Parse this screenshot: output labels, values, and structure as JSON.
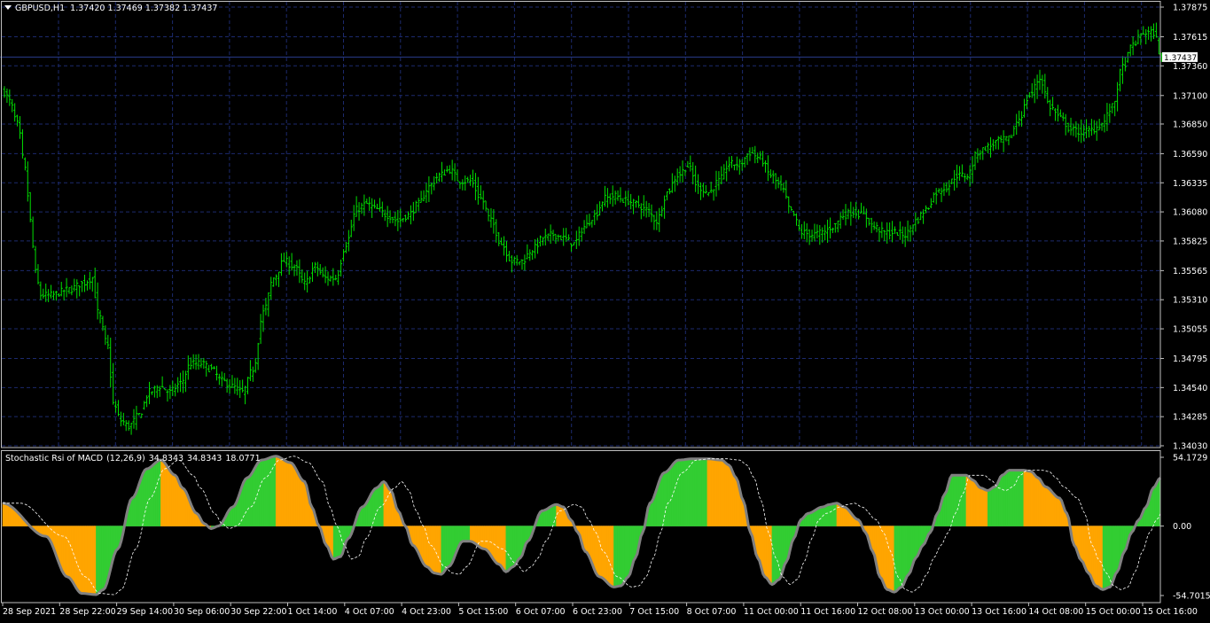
{
  "main_chart": {
    "symbol": "GBPUSD,H1",
    "ohlc": [
      "1.37420",
      "1.37469",
      "1.37382",
      "1.37437"
    ],
    "price_levels": [
      "1.37875",
      "1.37615",
      "1.37360",
      "1.37100",
      "1.36850",
      "1.36590",
      "1.36335",
      "1.36080",
      "1.35825",
      "1.35565",
      "1.35310",
      "1.35055",
      "1.34795",
      "1.34540",
      "1.34285",
      "1.34030"
    ],
    "current_price": "1.37437",
    "colors": {
      "background": "#000000",
      "grid": "#1c2a6e",
      "bars": "#00e000",
      "price_line": "#283c8c",
      "axis": "#c0c0c0"
    }
  },
  "indicator": {
    "name": "Stochastic Rsi of MACD",
    "params": "(12,26,9)",
    "values": [
      "34.8343",
      "34.8343",
      "18.0771"
    ],
    "levels": [
      "54.1729",
      "0.00",
      "-54.7015"
    ],
    "colors": {
      "up": "#32cd32",
      "down": "#ffa500",
      "line": "#808080",
      "signal": "#ffffff"
    }
  },
  "time_axis": {
    "labels": [
      "28 Sep 2021",
      "28 Sep 22:00",
      "29 Sep 14:00",
      "30 Sep 06:00",
      "30 Sep 22:00",
      "1 Oct 14:00",
      "4 Oct 07:00",
      "4 Oct 23:00",
      "5 Oct 15:00",
      "6 Oct 07:00",
      "6 Oct 23:00",
      "7 Oct 15:00",
      "8 Oct 07:00",
      "11 Oct 00:00",
      "11 Oct 16:00",
      "12 Oct 08:00",
      "13 Oct 00:00",
      "13 Oct 16:00",
      "14 Oct 08:00",
      "15 Oct 00:00",
      "15 Oct 16:00"
    ]
  },
  "chart_data": {
    "type": "ohlc",
    "title": "GBPUSD,H1",
    "ylim": [
      1.3403,
      1.37875
    ],
    "x_range": [
      "28 Sep 2021",
      "15 Oct 16:00"
    ],
    "grid": true,
    "anchors": [
      [
        0,
        1.3713
      ],
      [
        2,
        1.3705
      ],
      [
        5,
        1.3685
      ],
      [
        8,
        1.3645
      ],
      [
        10,
        1.36
      ],
      [
        12,
        1.3555
      ],
      [
        14,
        1.3535
      ],
      [
        18,
        1.3535
      ],
      [
        25,
        1.354
      ],
      [
        30,
        1.3545
      ],
      [
        34,
        1.355
      ],
      [
        36,
        1.352
      ],
      [
        40,
        1.349
      ],
      [
        42,
        1.344
      ],
      [
        45,
        1.3425
      ],
      [
        48,
        1.342
      ],
      [
        52,
        1.343
      ],
      [
        56,
        1.345
      ],
      [
        60,
        1.3455
      ],
      [
        64,
        1.345
      ],
      [
        68,
        1.3458
      ],
      [
        72,
        1.3475
      ],
      [
        76,
        1.3475
      ],
      [
        80,
        1.347
      ],
      [
        84,
        1.346
      ],
      [
        88,
        1.3455
      ],
      [
        92,
        1.345
      ],
      [
        96,
        1.347
      ],
      [
        100,
        1.352
      ],
      [
        104,
        1.355
      ],
      [
        108,
        1.3565
      ],
      [
        112,
        1.356
      ],
      [
        116,
        1.3545
      ],
      [
        120,
        1.356
      ],
      [
        124,
        1.355
      ],
      [
        128,
        1.355
      ],
      [
        132,
        1.358
      ],
      [
        136,
        1.361
      ],
      [
        140,
        1.3615
      ],
      [
        144,
        1.361
      ],
      [
        148,
        1.3605
      ],
      [
        152,
        1.36
      ],
      [
        156,
        1.3605
      ],
      [
        160,
        1.3615
      ],
      [
        164,
        1.363
      ],
      [
        168,
        1.364
      ],
      [
        172,
        1.3645
      ],
      [
        176,
        1.3635
      ],
      [
        180,
        1.3635
      ],
      [
        184,
        1.362
      ],
      [
        188,
        1.36
      ],
      [
        192,
        1.358
      ],
      [
        196,
        1.3565
      ],
      [
        200,
        1.3565
      ],
      [
        204,
        1.3575
      ],
      [
        208,
        1.3585
      ],
      [
        212,
        1.3588
      ],
      [
        216,
        1.3585
      ],
      [
        220,
        1.358
      ],
      [
        224,
        1.3595
      ],
      [
        228,
        1.3605
      ],
      [
        232,
        1.362
      ],
      [
        236,
        1.3622
      ],
      [
        240,
        1.3618
      ],
      [
        244,
        1.3615
      ],
      [
        248,
        1.361
      ],
      [
        252,
        1.36
      ],
      [
        256,
        1.3625
      ],
      [
        260,
        1.364
      ],
      [
        264,
        1.3648
      ],
      [
        268,
        1.363
      ],
      [
        272,
        1.3625
      ],
      [
        276,
        1.3635
      ],
      [
        280,
        1.365
      ],
      [
        284,
        1.365
      ],
      [
        288,
        1.366
      ],
      [
        292,
        1.3655
      ],
      [
        296,
        1.364
      ],
      [
        300,
        1.363
      ],
      [
        304,
        1.3608
      ],
      [
        308,
        1.359
      ],
      [
        312,
        1.3588
      ],
      [
        316,
        1.359
      ],
      [
        320,
        1.3595
      ],
      [
        324,
        1.3605
      ],
      [
        328,
        1.3608
      ],
      [
        332,
        1.3605
      ],
      [
        336,
        1.3595
      ],
      [
        340,
        1.359
      ],
      [
        344,
        1.359
      ],
      [
        348,
        1.3588
      ],
      [
        352,
        1.36
      ],
      [
        356,
        1.361
      ],
      [
        360,
        1.3625
      ],
      [
        364,
        1.363
      ],
      [
        368,
        1.364
      ],
      [
        372,
        1.364
      ],
      [
        376,
        1.366
      ],
      [
        380,
        1.3665
      ],
      [
        384,
        1.367
      ],
      [
        388,
        1.3672
      ],
      [
        392,
        1.369
      ],
      [
        396,
        1.371
      ],
      [
        400,
        1.3725
      ],
      [
        404,
        1.37
      ],
      [
        408,
        1.369
      ],
      [
        412,
        1.368
      ],
      [
        416,
        1.3678
      ],
      [
        420,
        1.368
      ],
      [
        424,
        1.3685
      ],
      [
        428,
        1.37
      ],
      [
        432,
        1.3735
      ],
      [
        436,
        1.3755
      ],
      [
        440,
        1.3765
      ],
      [
        444,
        1.3765
      ],
      [
        447,
        1.3743
      ]
    ]
  },
  "indicator_data": {
    "anchors": [
      [
        0,
        18
      ],
      [
        6,
        -8
      ],
      [
        9,
        -40
      ],
      [
        11,
        -53
      ],
      [
        13,
        -54
      ],
      [
        14,
        -50
      ],
      [
        16,
        -18
      ],
      [
        18,
        22
      ],
      [
        20,
        45
      ],
      [
        22,
        52
      ],
      [
        24,
        40
      ],
      [
        25,
        30
      ],
      [
        27,
        10
      ],
      [
        28,
        2
      ],
      [
        29,
        -2
      ],
      [
        30,
        0
      ],
      [
        32,
        15
      ],
      [
        34,
        38
      ],
      [
        36,
        52
      ],
      [
        38,
        55
      ],
      [
        40,
        50
      ],
      [
        42,
        35
      ],
      [
        43,
        15
      ],
      [
        44,
        0
      ],
      [
        45,
        -15
      ],
      [
        46,
        -26
      ],
      [
        47,
        -24
      ],
      [
        48,
        -10
      ],
      [
        50,
        15
      ],
      [
        52,
        30
      ],
      [
        53,
        35
      ],
      [
        54,
        28
      ],
      [
        55,
        12
      ],
      [
        56,
        0
      ],
      [
        57,
        -15
      ],
      [
        59,
        -32
      ],
      [
        60,
        -37
      ],
      [
        61,
        -38
      ],
      [
        62,
        -32
      ],
      [
        64,
        -12
      ],
      [
        65,
        -12
      ],
      [
        67,
        -18
      ],
      [
        69,
        -30
      ],
      [
        70,
        -36
      ],
      [
        71,
        -32
      ],
      [
        72,
        -25
      ],
      [
        73,
        -12
      ],
      [
        75,
        12
      ],
      [
        77,
        17
      ],
      [
        78,
        15
      ],
      [
        79,
        5
      ],
      [
        80,
        -5
      ],
      [
        81,
        -20
      ],
      [
        83,
        -40
      ],
      [
        85,
        -48
      ],
      [
        86,
        -47
      ],
      [
        87,
        -40
      ],
      [
        88,
        -25
      ],
      [
        89,
        -5
      ],
      [
        90,
        18
      ],
      [
        92,
        42
      ],
      [
        94,
        52
      ],
      [
        96,
        53
      ],
      [
        98,
        53
      ],
      [
        100,
        52
      ],
      [
        101,
        48
      ],
      [
        102,
        38
      ],
      [
        103,
        20
      ],
      [
        104,
        -5
      ],
      [
        105,
        -25
      ],
      [
        106,
        -40
      ],
      [
        107,
        -46
      ],
      [
        108,
        -42
      ],
      [
        109,
        -28
      ],
      [
        110,
        -10
      ],
      [
        111,
        5
      ],
      [
        112,
        10
      ],
      [
        114,
        15
      ],
      [
        115,
        17
      ],
      [
        116,
        18
      ],
      [
        117,
        15
      ],
      [
        119,
        5
      ],
      [
        120,
        -5
      ],
      [
        121,
        -20
      ],
      [
        122,
        -40
      ],
      [
        123,
        -50
      ],
      [
        124,
        -52
      ],
      [
        125,
        -48
      ],
      [
        126,
        -38
      ],
      [
        127,
        -25
      ],
      [
        128,
        -15
      ],
      [
        129,
        -5
      ],
      [
        130,
        10
      ],
      [
        131,
        25
      ],
      [
        132,
        40
      ],
      [
        134,
        40
      ],
      [
        135,
        36
      ],
      [
        136,
        30
      ],
      [
        137,
        28
      ],
      [
        138,
        31
      ],
      [
        139,
        40
      ],
      [
        140,
        44
      ],
      [
        142,
        44
      ],
      [
        143,
        43
      ],
      [
        144,
        38
      ],
      [
        145,
        31
      ],
      [
        147,
        22
      ],
      [
        148,
        10
      ],
      [
        149,
        -15
      ],
      [
        150,
        -27
      ],
      [
        151,
        -37
      ],
      [
        152,
        -47
      ],
      [
        153,
        -50
      ],
      [
        154,
        -48
      ],
      [
        155,
        -36
      ],
      [
        156,
        -20
      ],
      [
        157,
        -5
      ],
      [
        158,
        5
      ],
      [
        159,
        15
      ],
      [
        160,
        30
      ],
      [
        161,
        38
      ]
    ]
  }
}
